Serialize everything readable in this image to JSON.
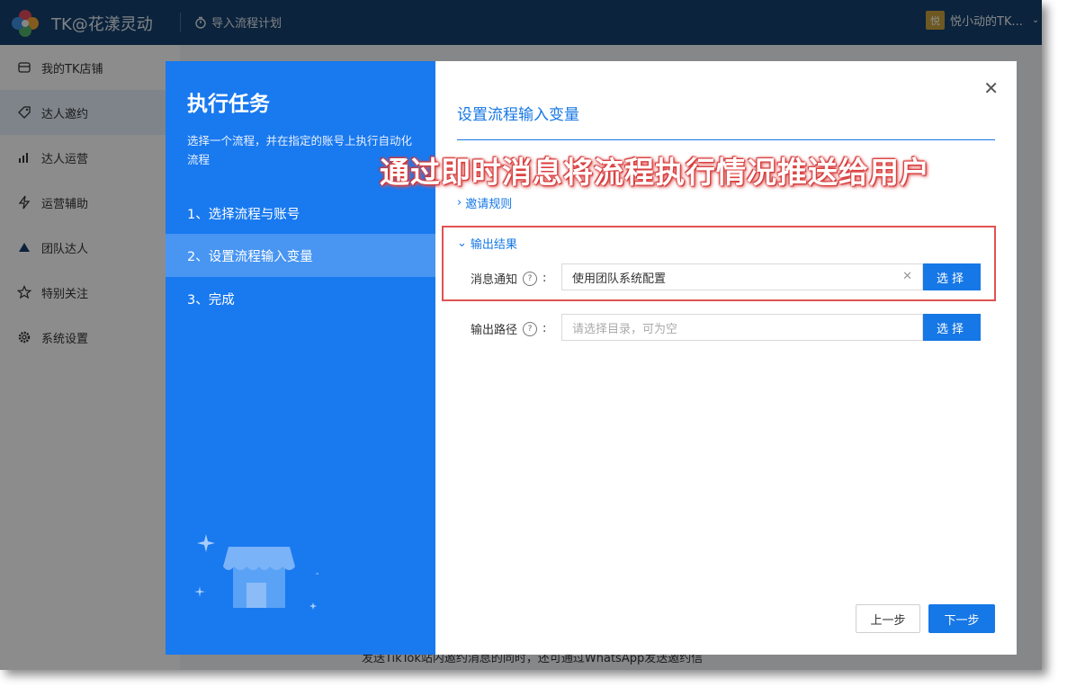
{
  "app": {
    "brand": "TK@花漾灵动",
    "import_plan": "导入流程计划",
    "user_avatar": "悦",
    "user_name": "悦小动的TK..."
  },
  "sidebar": {
    "items": [
      {
        "label": "我的TK店铺",
        "icon": "store-icon"
      },
      {
        "label": "达人邀约",
        "icon": "tag-icon"
      },
      {
        "label": "达人运营",
        "icon": "chart-icon"
      },
      {
        "label": "运营辅助",
        "icon": "lightning-icon"
      },
      {
        "label": "团队达人",
        "icon": "team-icon"
      },
      {
        "label": "特别关注",
        "icon": "star-icon"
      },
      {
        "label": "系统设置",
        "icon": "gear-icon"
      }
    ]
  },
  "background_text": "发送TikTok站内邀约消息的同时，还可通过WhatsApp发送邀约信",
  "modal": {
    "left": {
      "title": "执行任务",
      "description": "选择一个流程，并在指定的账号上执行自动化流程",
      "steps": [
        "1、选择流程与账号",
        "2、设置流程输入变量",
        "3、完成"
      ],
      "active_step": 1
    },
    "right": {
      "title": "设置流程输入变量",
      "annotation": "通过即时消息将流程执行情况推送给用户",
      "section_rules": "邀请规则",
      "section_output": "输出结果",
      "notify_label": "消息通知",
      "notify_value": "使用团队系统配置",
      "path_label": "输出路径",
      "path_placeholder": "请选择目录，可为空",
      "select_label": "选择",
      "prev_label": "上一步",
      "next_label": "下一步"
    }
  }
}
